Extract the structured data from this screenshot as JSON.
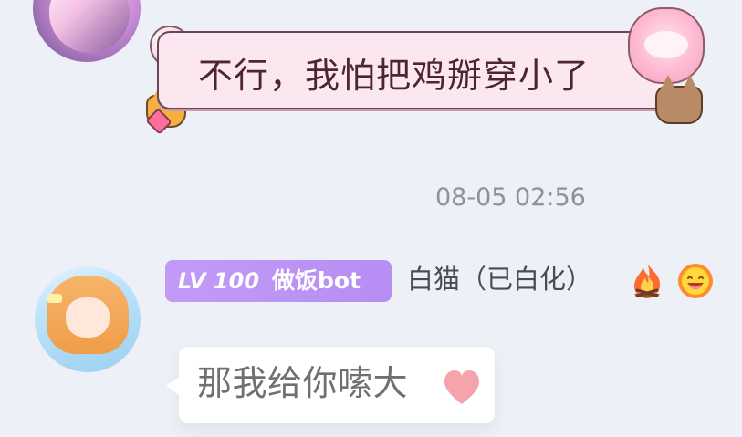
{
  "messages": [
    {
      "text": "不行，我怕把鸡掰穿小了"
    },
    {
      "badge_level": "LV 100",
      "badge_title": "做饭bot",
      "sender": "白猫（已白化）",
      "text": "那我给你嗦大"
    }
  ],
  "timestamp": "08-05 02:56",
  "icons": {
    "fire": "fire-icon",
    "smile": "smile-emoji-icon",
    "heart": "heart-icon"
  },
  "colors": {
    "background": "#eef0f8",
    "badge": "#c29af6",
    "timestamp": "#8e909a",
    "top_bubble": "#fbe7ef",
    "main_bubble": "#ffffff",
    "heart": "#f6a4ac"
  }
}
